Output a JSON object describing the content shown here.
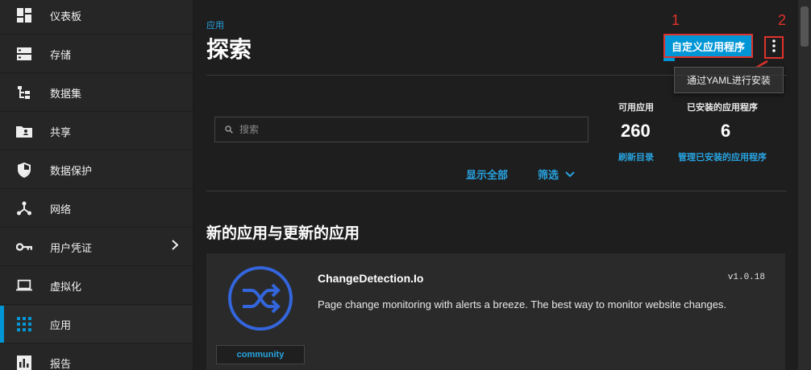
{
  "sidebar": {
    "items": [
      {
        "label": "仪表板",
        "icon": "dashboard-icon"
      },
      {
        "label": "存储",
        "icon": "storage-icon"
      },
      {
        "label": "数据集",
        "icon": "datasets-icon"
      },
      {
        "label": "共享",
        "icon": "shares-icon"
      },
      {
        "label": "数据保护",
        "icon": "shield-icon"
      },
      {
        "label": "网络",
        "icon": "network-icon"
      },
      {
        "label": "用户凭证",
        "icon": "key-icon"
      },
      {
        "label": "虚拟化",
        "icon": "laptop-icon"
      },
      {
        "label": "应用",
        "icon": "apps-grid-icon",
        "active": true
      },
      {
        "label": "报告",
        "icon": "reports-icon"
      }
    ]
  },
  "header": {
    "breadcrumb": "应用",
    "title": "探索",
    "custom_app_button": "自定义应用程序",
    "annotation_1": "1",
    "annotation_2": "2",
    "menu_item": "通过YAML进行安装"
  },
  "search": {
    "placeholder": "搜索"
  },
  "stats": {
    "available_label": "可用应用",
    "available_value": "260",
    "available_link": "刷新目录",
    "installed_label": "已安装的应用程序",
    "installed_value": "6",
    "installed_link": "管理已安装的应用程序"
  },
  "filters": {
    "show_all": "显示全部",
    "filter": "筛选"
  },
  "section_title": "新的应用与更新的应用",
  "app_card": {
    "name": "ChangeDetection.Io",
    "version": "v1.0.18",
    "description": "Page change monitoring with alerts a breeze. The best way to monitor website changes.",
    "tag": "community"
  },
  "colors": {
    "accent": "#0095d5",
    "annotation": "#e0322b",
    "link": "#28a3e0"
  }
}
